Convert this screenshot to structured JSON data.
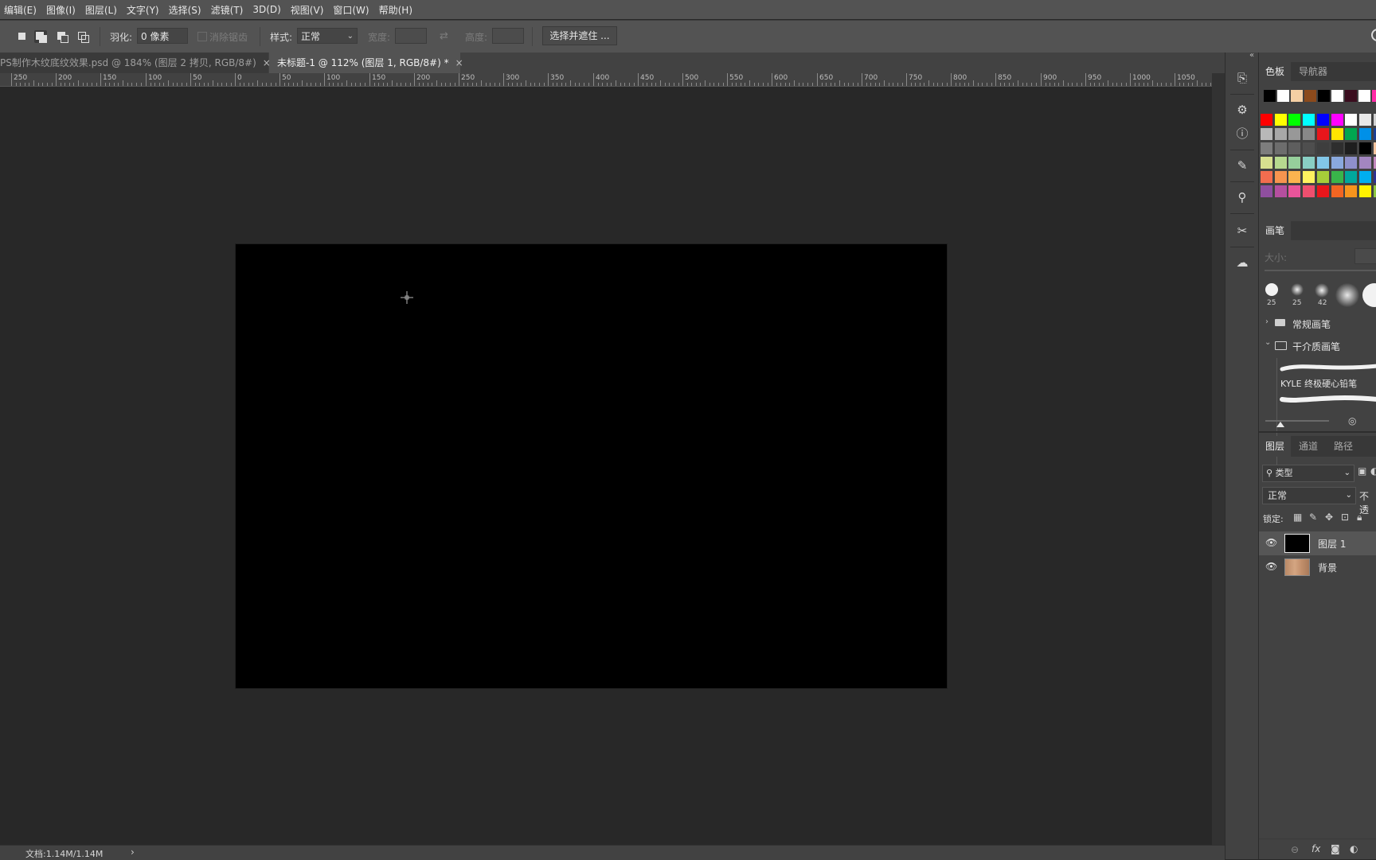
{
  "menu": [
    "编辑(E)",
    "图像(I)",
    "图层(L)",
    "文字(Y)",
    "选择(S)",
    "滤镜(T)",
    "3D(D)",
    "视图(V)",
    "窗口(W)",
    "帮助(H)"
  ],
  "options": {
    "feather_label": "羽化:",
    "feather_value": "0 像素",
    "antialias_label": "消除锯齿",
    "style_label": "样式:",
    "style_value": "正常",
    "width_label": "宽度:",
    "height_label": "高度:",
    "select_mask_button": "选择并遮住 ..."
  },
  "tabs": [
    {
      "label": "PS制作木纹底纹效果.psd @ 184% (图层 2 拷贝, RGB/8#)",
      "close": "×",
      "active": false
    },
    {
      "label": "未标题-1 @ 112% (图层 1, RGB/8#) *",
      "close": "×",
      "active": true
    }
  ],
  "ruler_labels": [
    "250",
    "200",
    "150",
    "100",
    "50",
    "0",
    "50",
    "100",
    "150",
    "200",
    "250",
    "300",
    "350",
    "400",
    "450",
    "500",
    "550",
    "600",
    "650",
    "700",
    "750",
    "800",
    "850",
    "900",
    "950",
    "1000",
    "1050"
  ],
  "status": {
    "doc": "文档:1.14M/1.14M",
    "arrow": "›"
  },
  "swatches_panel": {
    "tabs": [
      "色板",
      "导航器"
    ],
    "recent": [
      "#000000",
      "#ffffff",
      "#f5cfa4",
      "#8b4a1c",
      "#000000",
      "#ffffff",
      "#3a0d1e",
      "#ffffff",
      "#ff2aa6"
    ],
    "grid": [
      [
        "#ff0000",
        "#ffff00",
        "#00ff00",
        "#00ffff",
        "#0000ff",
        "#ff00ff",
        "#ffffff",
        "#e8e8e8",
        "#d0d0d0"
      ],
      [
        "#b8b8b8",
        "#a8a8a8",
        "#989898",
        "#888888",
        "#e8161b",
        "#ffe600",
        "#00a650",
        "#0090e8",
        "#1c3f94"
      ],
      [
        "#7d7d7d",
        "#6d6d6d",
        "#5e5e5e",
        "#4e4e4e",
        "#3e3e3e",
        "#2e2e2e",
        "#1e1e1e",
        "#000000",
        "#f7c59f"
      ],
      [
        "#d7e08f",
        "#b6d98f",
        "#96cf9b",
        "#89cfc4",
        "#82c7e8",
        "#8aa9de",
        "#8f90cb",
        "#a386c0",
        "#c388be"
      ],
      [
        "#f26d4f",
        "#f7944f",
        "#fbb34f",
        "#fff25f",
        "#a6ce39",
        "#39b54a",
        "#00a79d",
        "#00aeef",
        "#2e3192"
      ],
      [
        "#8f4f9f",
        "#b54f9f",
        "#e8549a",
        "#ee4f6f",
        "#e8161b",
        "#f26522",
        "#f7941d",
        "#fff200",
        "#8dc63f"
      ]
    ]
  },
  "brush_panel": {
    "tab": "画笔",
    "size_label": "大小:",
    "presets": [
      "25",
      "25",
      "42"
    ],
    "groups": [
      "常规画笔",
      "干介质画笔"
    ],
    "brush_name": "KYLE 终极硬心铅笔"
  },
  "layers_panel": {
    "tabs": [
      "图层",
      "通道",
      "路径"
    ],
    "filter_value": "类型",
    "blend_mode": "正常",
    "opacity_label": "不透",
    "lock_label": "锁定:",
    "layers": [
      {
        "name": "图层 1",
        "selected": true
      },
      {
        "name": "背景",
        "selected": false
      }
    ]
  }
}
